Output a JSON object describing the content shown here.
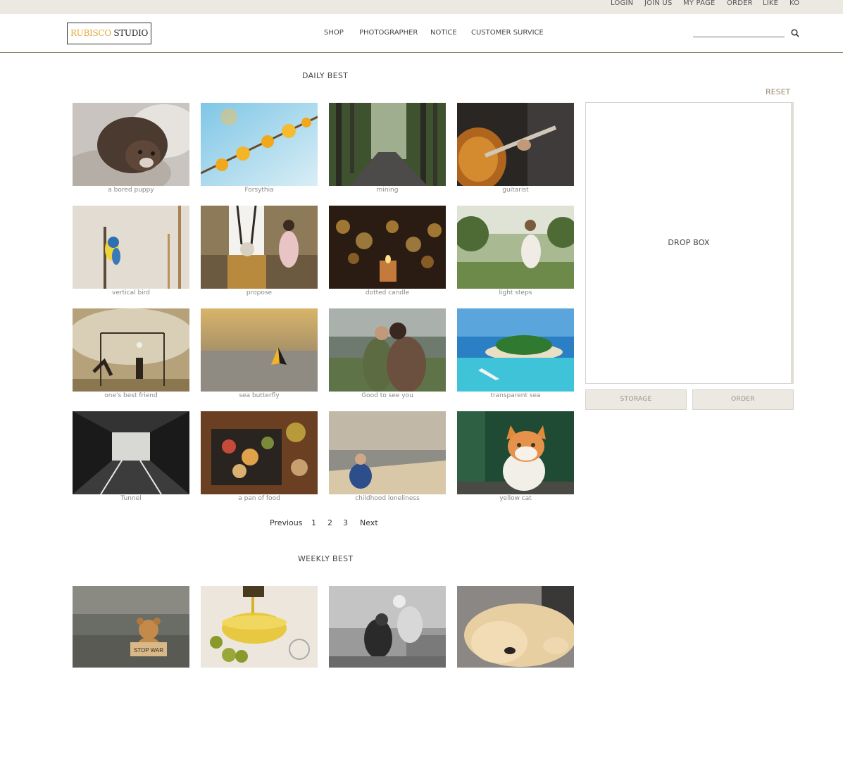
{
  "topbar": {
    "links": [
      "LOGIN",
      "JOIN US",
      "MY PAGE",
      "ORDER",
      "LIKE",
      "KO"
    ]
  },
  "header": {
    "logo_part1": "RUBISCO",
    "logo_part2": "STUDIO",
    "nav": [
      "SHOP",
      "PHOTOGRAPHER",
      "NOTICE",
      "CUSTOMER SURVICE"
    ],
    "search_value": "",
    "search_icon": "search-icon"
  },
  "daily": {
    "title": "DAILY BEST",
    "items": [
      {
        "caption": "a bored puppy"
      },
      {
        "caption": "Forsythia"
      },
      {
        "caption": "mining"
      },
      {
        "caption": "guitarist"
      },
      {
        "caption": "vertical bird"
      },
      {
        "caption": "propose"
      },
      {
        "caption": "dotted candle"
      },
      {
        "caption": "light steps"
      },
      {
        "caption": "one's best friend"
      },
      {
        "caption": "sea butterfly"
      },
      {
        "caption": "Good to see you"
      },
      {
        "caption": "transparent sea"
      },
      {
        "caption": "Tunnel"
      },
      {
        "caption": "a pan of food"
      },
      {
        "caption": "childhood loneliness"
      },
      {
        "caption": "yellow cat"
      }
    ]
  },
  "pagination": {
    "previous": "Previous",
    "pages": [
      "1",
      "2",
      "3"
    ],
    "next": "Next"
  },
  "weekly": {
    "title": "WEEKLY BEST",
    "sign_text": "STOP WAR"
  },
  "panel": {
    "reset": "RESET",
    "dropbox": "DROP BOX",
    "storage": "STORAGE",
    "order": "ORDER"
  },
  "colors": {
    "topbar_bg": "#ece9e3",
    "logo_accent": "#e0a93c",
    "reset_text": "#a08b6c",
    "header_border": "#8b7d6b"
  }
}
